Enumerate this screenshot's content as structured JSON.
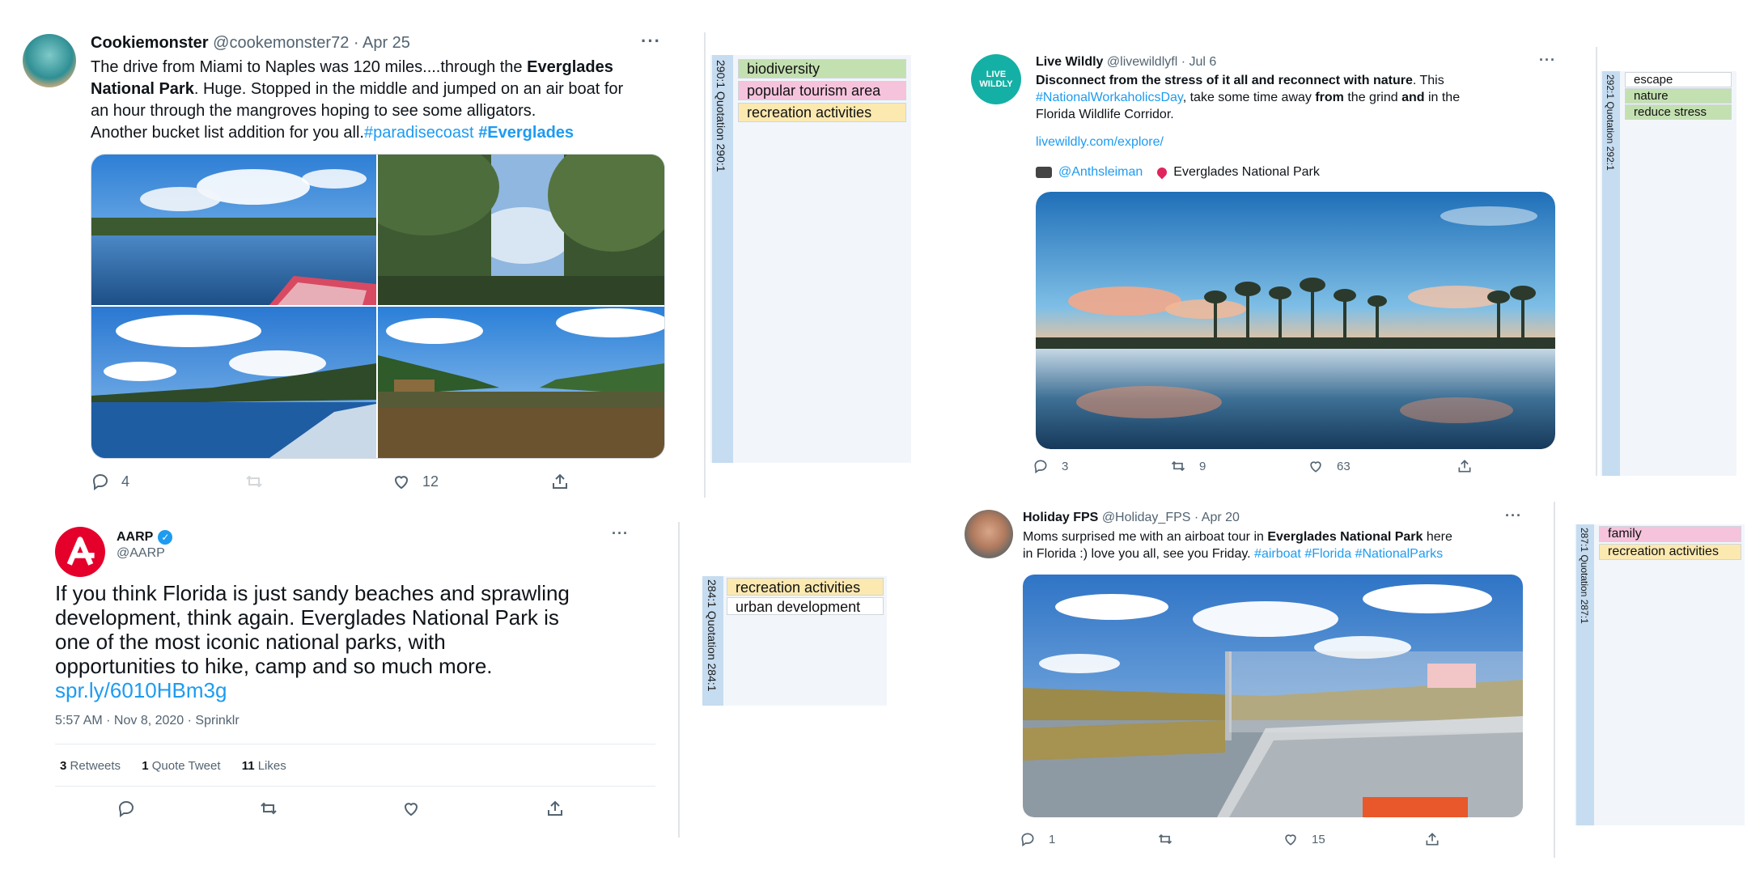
{
  "colors": {
    "biodiversity": "#c3e0b0",
    "tourism": "#f6c3dd",
    "recreation": "#fbe9b0",
    "nature": "#c3e0b0",
    "escape": "#ffffff",
    "reduce_stress": "#c3e0b0",
    "family": "#f6c3dd",
    "urban": "#ffffff",
    "link": "#1d9bf0"
  },
  "tweet1": {
    "name": "Cookiemonster",
    "handle": "@cookemonster72 · Apr 25",
    "more": "···",
    "line1a": "The drive from Miami to Naples was 120 miles....through the ",
    "line1b": "Everglades",
    "line2a": "National Park",
    "line2b": ". Huge. Stopped in the middle and jumped on an air boat for",
    "line3": "an hour through the mangroves hoping to see some alligators.",
    "line4a": "Another bucket list addition for you all.",
    "line4b": "#paradisecoast",
    "line4c": "#Everglades",
    "replies": "4",
    "likes": "12",
    "panel_label": "290:1 Quotation 290:1",
    "codes": [
      "biodiversity",
      "popular tourism area",
      "recreation activities"
    ]
  },
  "tweet2": {
    "name": "Live Wildly",
    "handle": "@livewildlyfl · Jul 6",
    "more": "···",
    "avatar_text": "LIVE WILDLY",
    "line1a": "Disconnect from the stress of it all and reconnect with nature",
    "line1b": ". This",
    "line2a": "#NationalWorkaholicsDay",
    "line2b": ", take some time away ",
    "line2c": "from",
    "line2d": " the grind ",
    "line2e": "and",
    "line2f": " in the",
    "line3": "Florida Wildlife Corridor.",
    "url": "livewildly.com/explore/",
    "credit_handle": "@Anthsleiman",
    "credit_place": "Everglades National Park",
    "replies": "3",
    "retweets": "9",
    "likes": "63",
    "panel_label": "292:1 Quotation 292:1",
    "codes": [
      "escape",
      "nature",
      "reduce stress"
    ]
  },
  "tweet3": {
    "name": "AARP",
    "handle": "@AARP",
    "more": "···",
    "body1": "If you think Florida is just sandy beaches and sprawling",
    "body2": "development, think again. Everglades National Park is",
    "body3": "one of the most iconic national parks, with",
    "body4": "opportunities to hike, camp and so much more.",
    "url": "spr.ly/6010HBm3g",
    "meta": "5:57 AM · Nov 8, 2020 · Sprinklr",
    "retweets_count": "3",
    "retweets_label": "Retweets",
    "quote_count": "1",
    "quote_label": "Quote Tweet",
    "likes_count": "11",
    "likes_label": "Likes",
    "panel_label": "284:1 Quotation 284:1",
    "codes": [
      "recreation activities",
      "urban development"
    ]
  },
  "tweet4": {
    "name": "Holiday FPS",
    "handle": "@Holiday_FPS · Apr 20",
    "more": "···",
    "line1a": "Moms surprised me with an airboat tour in ",
    "line1b": "Everglades National Park",
    "line1c": " here",
    "line2a": "in Florida :) love you all, see you Friday. ",
    "line2b": "#airboat #Florida #NationalParks",
    "replies": "1",
    "likes": "15",
    "panel_label": "287:1 Quotation 287:1",
    "codes": [
      "family",
      "recreation activities"
    ]
  }
}
